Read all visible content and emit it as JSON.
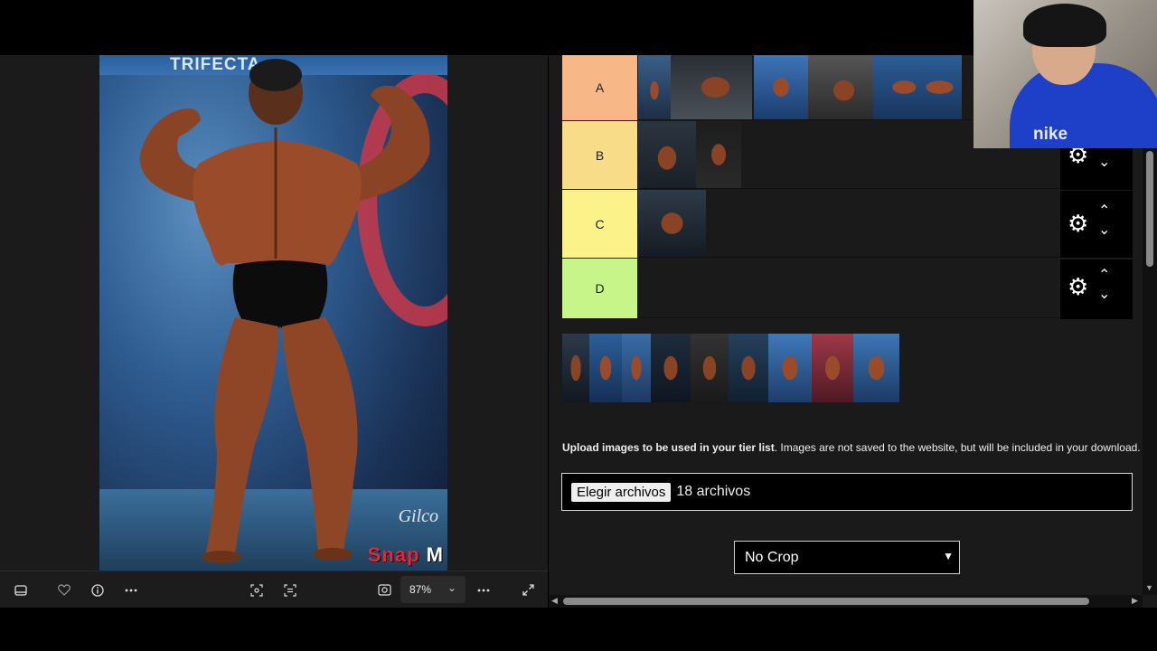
{
  "viewer": {
    "photo_watermark": "Snap",
    "photo_watermark_m": "M",
    "photo_banner": "TRIFECTA",
    "photo_signature": "Gilco",
    "zoom_level": "87%",
    "toolbar": {
      "filmstrip_icon": "filmstrip-icon",
      "favorite_icon": "heart-icon",
      "info_icon": "info-icon",
      "more_icon": "more-icon",
      "crop_icon": "crop-icon",
      "ocr_icon": "scan-text-icon",
      "fit_icon": "fit-screen-icon",
      "more2_icon": "more-icon",
      "fullscreen_icon": "fullscreen-icon"
    }
  },
  "tierlist": {
    "tiers": [
      {
        "label": "A",
        "color": "#f7b786",
        "thumb_count": 5
      },
      {
        "label": "B",
        "color": "#f8dc88",
        "thumb_count": 2
      },
      {
        "label": "C",
        "color": "#fbf38a",
        "thumb_count": 1
      },
      {
        "label": "D",
        "color": "#c8f58a",
        "thumb_count": 0
      }
    ],
    "unsorted_thumb_count": 10,
    "upload_note_bold": "Upload images to be used in your tier list",
    "upload_note_rest": ". Images are not saved to the website, but will be included in your download.",
    "file_button": "Elegir archivos",
    "file_count": "18 archivos",
    "crop_option": "No Crop"
  },
  "webcam": {
    "shirt_text": "nike"
  }
}
